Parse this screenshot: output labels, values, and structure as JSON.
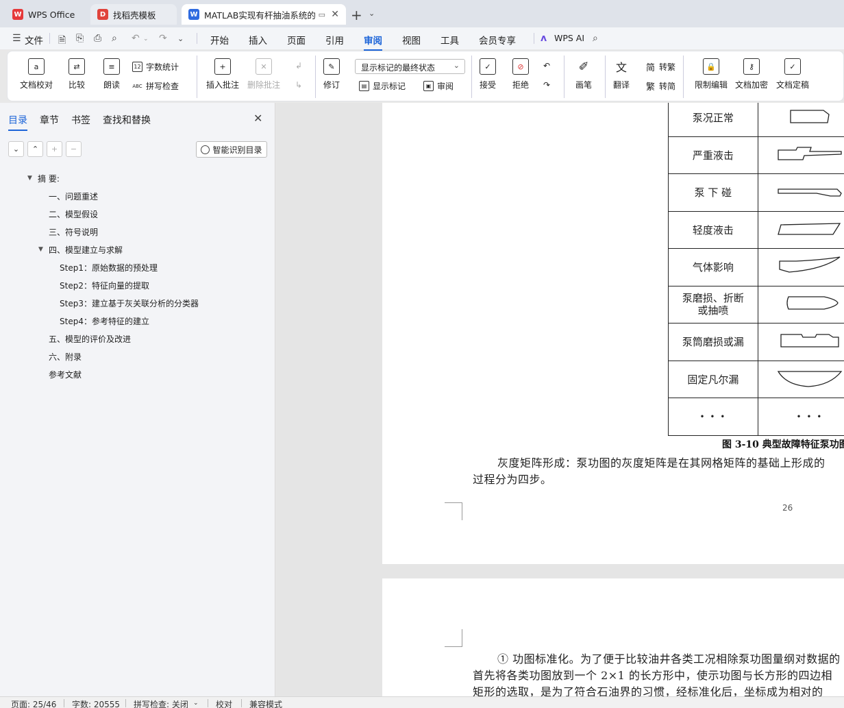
{
  "tabs": [
    {
      "label": "WPS Office",
      "icon": "wps-logo-icon"
    },
    {
      "label": "找稻壳模板",
      "icon": "docer-icon"
    },
    {
      "label": "MATLAB实现有杆抽油系统的",
      "icon": "word-doc-icon"
    }
  ],
  "menu": {
    "file": "文件",
    "items": [
      "开始",
      "插入",
      "页面",
      "引用",
      "审阅",
      "视图",
      "工具",
      "会员专享"
    ],
    "active": "审阅",
    "wps_ai": "WPS AI"
  },
  "ribbon": {
    "doc_check": "文档校对",
    "compare": "比较",
    "read_aloud": "朗读",
    "word_count": "字数统计",
    "spell_check": "拼写检查",
    "insert_comment": "插入批注",
    "delete_comment": "删除批注",
    "revise": "修订",
    "markup_state": "显示标记的最终状态",
    "show_markup": "显示标记",
    "review": "审阅",
    "accept": "接受",
    "reject": "拒绝",
    "pen": "画笔",
    "translate": "翻译",
    "to_traditional": "转繁",
    "to_simplified": "转简",
    "restrict_edit": "限制编辑",
    "encrypt": "文档加密",
    "finalize": "文档定稿"
  },
  "sidebar": {
    "tabs": [
      "目录",
      "章节",
      "书签",
      "查找和替换"
    ],
    "smart_toc": "智能识别目录",
    "toc": [
      {
        "label": "摘  要:",
        "level": 0
      },
      {
        "label": "一、问题重述",
        "level": 1
      },
      {
        "label": "二、模型假设",
        "level": 1
      },
      {
        "label": "三、符号说明",
        "level": 1
      },
      {
        "label": "四、模型建立与求解",
        "level": 1
      },
      {
        "label": "Step1：原始数据的预处理",
        "level": 2
      },
      {
        "label": "Step2：特征向量的提取",
        "level": 2
      },
      {
        "label": "Step3：建立基于灰关联分析的分类器",
        "level": 2
      },
      {
        "label": "Step4：参考特征的建立",
        "level": 2
      },
      {
        "label": "五、模型的评价及改进",
        "level": 1
      },
      {
        "label": "六、附录",
        "level": 1
      },
      {
        "label": "参考文献",
        "level": 1
      }
    ]
  },
  "document": {
    "table_rows": [
      "泵况正常",
      "严重液击",
      "泵 下 碰",
      "轻度液击",
      "气体影响",
      "泵磨损、折断|或抽喷",
      "泵筒磨损或漏",
      "固定凡尔漏",
      "• • •"
    ],
    "last_right": "• • •",
    "caption": "图 3-10 典型故障特征泵功图",
    "para1_line1": "灰度矩阵形成：泵功图的灰度矩阵是在其网格矩阵的基础上形成的",
    "para1_line2": "过程分为四步。",
    "page_number": "26",
    "para2_line1": "① 功图标准化。为了便于比较油井各类工况相除泵功图量纲对数据的",
    "para2_line2": "首先将各类功图放到一个 2×1 的长方形中，使示功图与长方形的四边相",
    "para2_line3": "矩形的选取，是为了符合石油界的习惯，经标准化后，坐标成为相对的"
  },
  "status": {
    "page": "页面: 25/46",
    "words": "字数: 20555",
    "spell": "拼写检查: 关闭",
    "proof": "校对",
    "compat": "兼容模式"
  }
}
